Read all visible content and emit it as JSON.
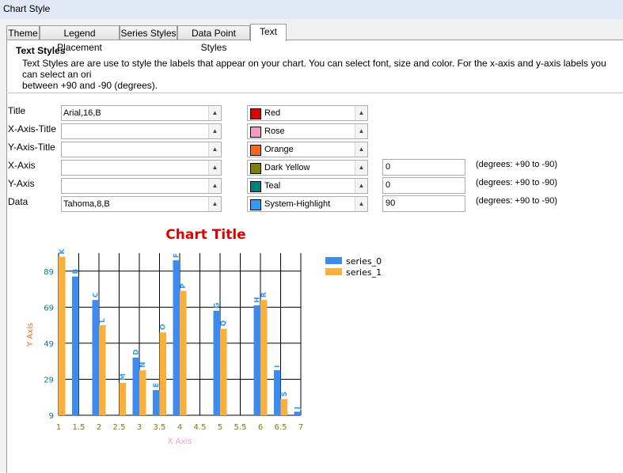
{
  "window": {
    "title": "Chart Style"
  },
  "tabs": [
    {
      "label": "Theme"
    },
    {
      "label": "Legend Placement"
    },
    {
      "label": "Series Styles"
    },
    {
      "label": "Data Point Styles"
    },
    {
      "label": "Text"
    }
  ],
  "section": {
    "title": "Text Styles",
    "description": "Text Styles are are use to style the labels that appear on your chart. You can select font, size and color. For the x-axis and y-axis labels you can select an ori\nbetween +90 and -90 (degrees)."
  },
  "rows": [
    {
      "label": "Title",
      "font": "Arial,16,B",
      "color_name": "Red",
      "color": "#e00000",
      "angle": null,
      "degrees_note": null
    },
    {
      "label": "X-Axis-Title",
      "font": "",
      "color_name": "Rose",
      "color": "#f49ac6",
      "angle": null,
      "degrees_note": null
    },
    {
      "label": "Y-Axis-Title",
      "font": "",
      "color_name": "Orange",
      "color": "#f26b1d",
      "angle": null,
      "degrees_note": null
    },
    {
      "label": "X-Axis",
      "font": "",
      "color_name": "Dark Yellow",
      "color": "#7f7f00",
      "angle": "0",
      "degrees_note": "(degrees: +90 to -90)"
    },
    {
      "label": "Y-Axis",
      "font": "",
      "color_name": "Teal",
      "color": "#008080",
      "angle": "0",
      "degrees_note": "(degrees: +90 to -90)"
    },
    {
      "label": "Data",
      "font": "Tahoma,8,B",
      "color_name": "System-Highlight",
      "color": "#3399ff",
      "angle": "90",
      "degrees_note": "(degrees: +90 to -90)"
    }
  ],
  "chart_data": {
    "type": "bar",
    "title": "Chart Title",
    "xlabel": "X Axis",
    "ylabel": "Y Axis",
    "x_ticks": [
      "1",
      "1.5",
      "2",
      "2.5",
      "3",
      "3.5",
      "4",
      "4.5",
      "5",
      "5.5",
      "6",
      "6.5",
      "7"
    ],
    "y_ticks": [
      "9",
      "29",
      "49",
      "69",
      "89"
    ],
    "xlim": [
      1,
      7
    ],
    "ylim": [
      9,
      99
    ],
    "grid": true,
    "legend_position": "top-right",
    "series": [
      {
        "name": "series_0",
        "color": "#3d8af0",
        "points": [
          {
            "x": 1.5,
            "y": 86,
            "label": "B"
          },
          {
            "x": 2,
            "y": 73,
            "label": "C"
          },
          {
            "x": 3,
            "y": 41,
            "label": "D"
          },
          {
            "x": 3.5,
            "y": 23,
            "label": "E"
          },
          {
            "x": 4,
            "y": 95,
            "label": "F"
          },
          {
            "x": 5,
            "y": 67,
            "label": "G"
          },
          {
            "x": 6,
            "y": 70,
            "label": "H"
          },
          {
            "x": 6.5,
            "y": 34,
            "label": "I"
          },
          {
            "x": 7,
            "y": 11,
            "label": "J"
          }
        ]
      },
      {
        "name": "series_1",
        "color": "#fbb03b",
        "points": [
          {
            "x": 1,
            "y": 97,
            "label": "K"
          },
          {
            "x": 2,
            "y": 59,
            "label": "L"
          },
          {
            "x": 2.5,
            "y": 27,
            "label": "M"
          },
          {
            "x": 3,
            "y": 34,
            "label": "N"
          },
          {
            "x": 3.5,
            "y": 55,
            "label": "O"
          },
          {
            "x": 4,
            "y": 78,
            "label": "P"
          },
          {
            "x": 5,
            "y": 57,
            "label": "Q"
          },
          {
            "x": 6,
            "y": 73,
            "label": "R"
          },
          {
            "x": 6.5,
            "y": 18,
            "label": "S"
          }
        ]
      }
    ],
    "colors": {
      "title": "#e00000",
      "xlabel": "#f49ac6",
      "ylabel": "#f26b1d",
      "xticks": "#7f7f00",
      "yticks": "#008080",
      "data_labels": "#3399ff"
    }
  }
}
